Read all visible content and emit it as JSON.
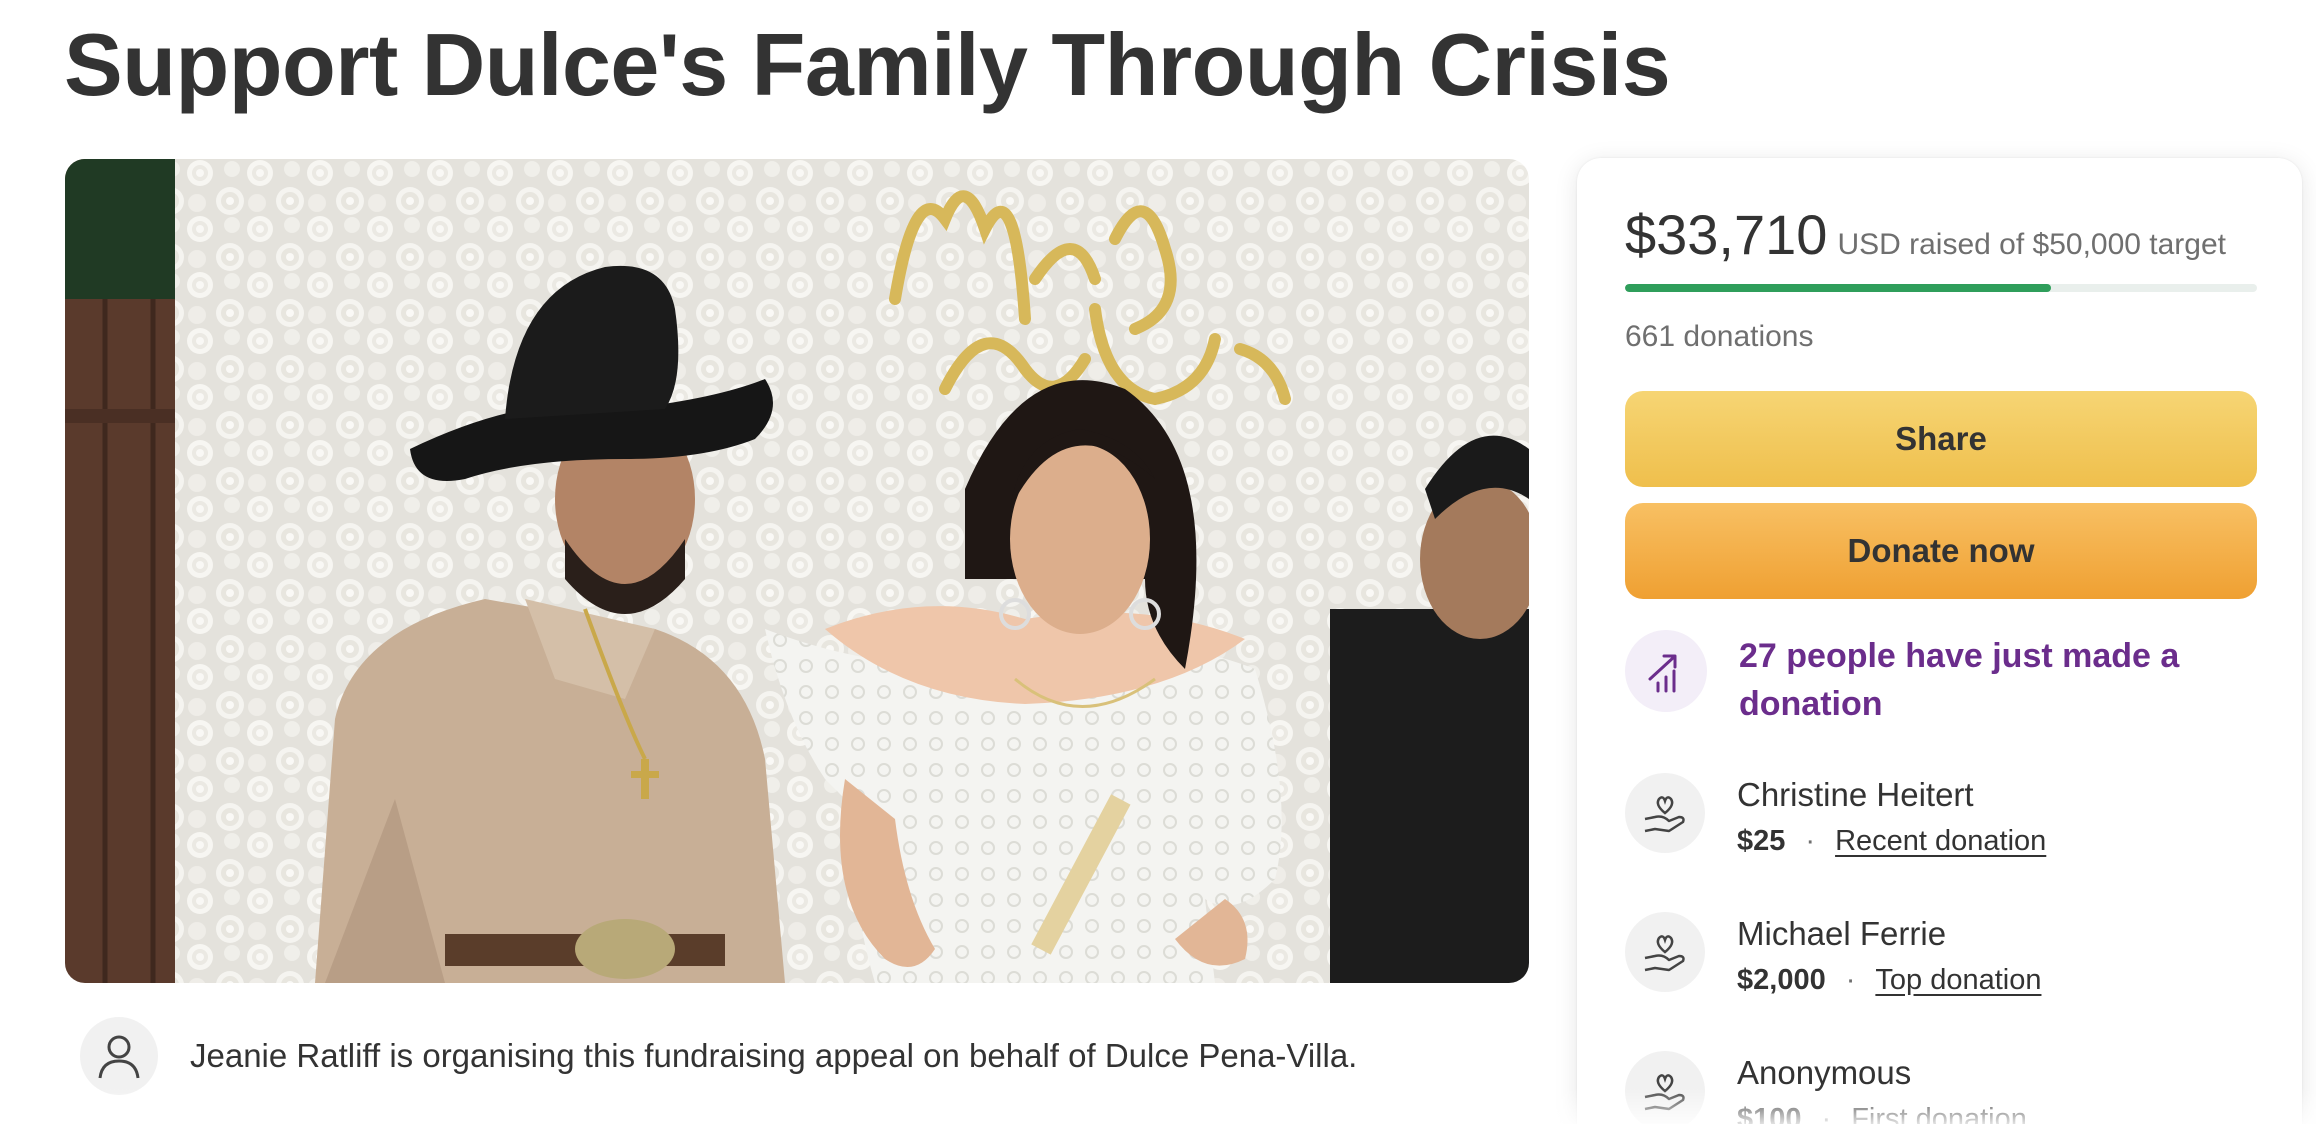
{
  "page": {
    "title": "Support Dulce's Family Through Crisis"
  },
  "hero": {
    "sign_text": "Mrs & Mrs"
  },
  "organiser": {
    "text": "Jeanie Ratliff is organising this fundraising appeal on behalf of Dulce Pena-Villa.",
    "icon": "person-icon"
  },
  "stats": {
    "raised": "$33,710",
    "raised_detail": "USD raised of $50,000 target",
    "progress_fraction": 0.674,
    "donations": "661 donations"
  },
  "buttons": {
    "share": "Share",
    "donate": "Donate now"
  },
  "trend": {
    "text": "27 people have just made a donation",
    "icon": "trending-chart-icon"
  },
  "donors": [
    {
      "name": "Christine Heitert",
      "amount": "$25",
      "tag": "Recent donation"
    },
    {
      "name": "Michael Ferrie",
      "amount": "$2,000",
      "tag": "Top donation"
    },
    {
      "name": "Anonymous",
      "amount": "$100",
      "tag": "First donation"
    }
  ],
  "colors": {
    "progress": "#2f9e5b",
    "share_button": "#f2c85e",
    "donate_button": "#f3ad45",
    "trend_text": "#6b2d8c"
  }
}
